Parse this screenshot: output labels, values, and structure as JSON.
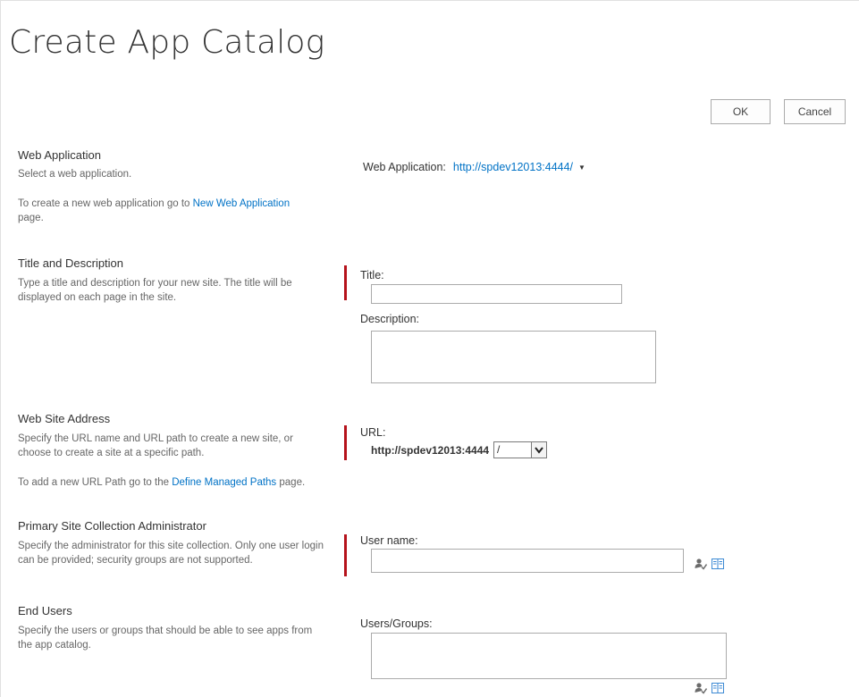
{
  "page": {
    "title": "Create App Catalog"
  },
  "buttons": {
    "ok_label": "OK",
    "cancel_label": "Cancel"
  },
  "sections": {
    "web_application": {
      "heading": "Web Application",
      "desc1": "Select a web application.",
      "desc2_prefix": "To create a new web application go to ",
      "desc2_link": "New Web Application",
      "desc2_suffix": "page.",
      "field_label": "Web Application:",
      "field_value": "http://spdev12013:4444/"
    },
    "title_description": {
      "heading": "Title and Description",
      "desc": "Type a title and description for your new site. The title will be displayed on each page in the site.",
      "title_label": "Title:",
      "title_value": "",
      "description_label": "Description:",
      "description_value": ""
    },
    "web_site_address": {
      "heading": "Web Site Address",
      "desc1": "Specify the URL name and URL path to create a new site, or choose to create a site at a specific path.",
      "desc2_prefix": "To add a new URL Path go to the ",
      "desc2_link": "Define Managed Paths",
      "desc2_suffix": " page.",
      "url_label": "URL:",
      "url_prefix": "http://spdev12013:4444",
      "url_path_selected": "/"
    },
    "primary_admin": {
      "heading": "Primary Site Collection Administrator",
      "desc": "Specify the administrator for this site collection. Only one user login can be provided; security groups are not supported.",
      "user_label": "User name:",
      "user_value": ""
    },
    "end_users": {
      "heading": "End Users",
      "desc": "Specify the users or groups that should be able to see apps from the app catalog.",
      "users_label": "Users/Groups:",
      "users_value": ""
    }
  },
  "icons": {
    "check_names": "check-names-icon",
    "browse": "browse-directory-icon"
  },
  "colors": {
    "link": "#0072c6",
    "required_bar": "#b5121b",
    "border": "#ababab"
  }
}
